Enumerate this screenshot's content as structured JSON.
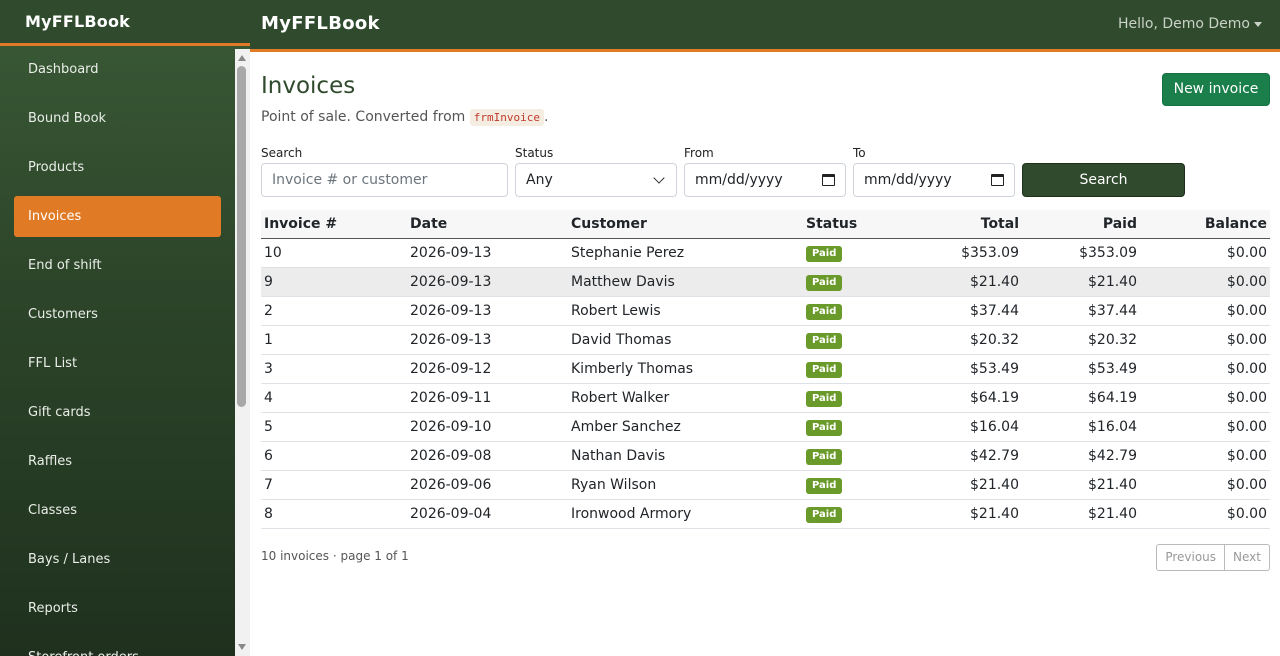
{
  "app": {
    "brand": "MyFFLBook"
  },
  "topbar": {
    "brand": "MyFFLBook",
    "user_label": "Hello, Demo Demo"
  },
  "sidebar": {
    "items": [
      {
        "label": "Dashboard"
      },
      {
        "label": "Bound Book"
      },
      {
        "label": "Products"
      },
      {
        "label": "Invoices",
        "active": true
      },
      {
        "label": "End of shift"
      },
      {
        "label": "Customers"
      },
      {
        "label": "FFL List"
      },
      {
        "label": "Gift cards"
      },
      {
        "label": "Raffles"
      },
      {
        "label": "Classes"
      },
      {
        "label": "Bays / Lanes"
      },
      {
        "label": "Reports"
      },
      {
        "label": "Storefront orders"
      }
    ]
  },
  "page": {
    "title": "Invoices",
    "subtitle_prefix": "Point of sale. Converted from",
    "subtitle_code": "frmInvoice",
    "subtitle_suffix": ".",
    "new_button": "New invoice"
  },
  "filters": {
    "search_label": "Search",
    "search_placeholder": "Invoice # or customer",
    "status_label": "Status",
    "status_value": "Any",
    "from_label": "From",
    "from_placeholder": "mm/dd/yyyy",
    "to_label": "To",
    "to_placeholder": "mm/dd/yyyy",
    "search_button": "Search"
  },
  "table": {
    "headers": [
      "Invoice #",
      "Date",
      "Customer",
      "Status",
      "Total",
      "Paid",
      "Balance"
    ],
    "rows": [
      {
        "invoice": "10",
        "date": "2026-09-13",
        "customer": "Stephanie Perez",
        "status": "Paid",
        "total": "$353.09",
        "paid": "$353.09",
        "balance": "$0.00"
      },
      {
        "invoice": "9",
        "date": "2026-09-13",
        "customer": "Matthew Davis",
        "status": "Paid",
        "total": "$21.40",
        "paid": "$21.40",
        "balance": "$0.00"
      },
      {
        "invoice": "2",
        "date": "2026-09-13",
        "customer": "Robert Lewis",
        "status": "Paid",
        "total": "$37.44",
        "paid": "$37.44",
        "balance": "$0.00"
      },
      {
        "invoice": "1",
        "date": "2026-09-13",
        "customer": "David Thomas",
        "status": "Paid",
        "total": "$20.32",
        "paid": "$20.32",
        "balance": "$0.00"
      },
      {
        "invoice": "3",
        "date": "2026-09-12",
        "customer": "Kimberly Thomas",
        "status": "Paid",
        "total": "$53.49",
        "paid": "$53.49",
        "balance": "$0.00"
      },
      {
        "invoice": "4",
        "date": "2026-09-11",
        "customer": "Robert Walker",
        "status": "Paid",
        "total": "$64.19",
        "paid": "$64.19",
        "balance": "$0.00"
      },
      {
        "invoice": "5",
        "date": "2026-09-10",
        "customer": "Amber Sanchez",
        "status": "Paid",
        "total": "$16.04",
        "paid": "$16.04",
        "balance": "$0.00"
      },
      {
        "invoice": "6",
        "date": "2026-09-08",
        "customer": "Nathan Davis",
        "status": "Paid",
        "total": "$42.79",
        "paid": "$42.79",
        "balance": "$0.00"
      },
      {
        "invoice": "7",
        "date": "2026-09-06",
        "customer": "Ryan Wilson",
        "status": "Paid",
        "total": "$21.40",
        "paid": "$21.40",
        "balance": "$0.00"
      },
      {
        "invoice": "8",
        "date": "2026-09-04",
        "customer": "Ironwood Armory",
        "status": "Paid",
        "total": "$21.40",
        "paid": "$21.40",
        "balance": "$0.00"
      }
    ]
  },
  "footer": {
    "summary": "10 invoices · page 1 of 1",
    "previous": "Previous",
    "next": "Next"
  },
  "colors": {
    "brand_green": "#2f4a2c",
    "accent_orange": "#e07a24",
    "primary_button": "#1a7f4b",
    "paid_badge": "#6a9a2a"
  }
}
